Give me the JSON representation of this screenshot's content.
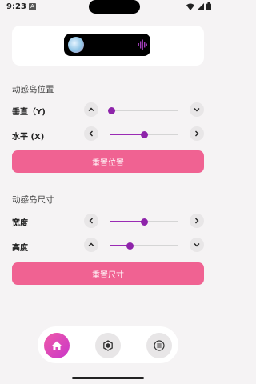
{
  "status_bar": {
    "time": "9:23",
    "notification_letter": "A"
  },
  "island_preview": {
    "icons": [
      "album-art-icon",
      "audio-waveform-icon"
    ]
  },
  "position_section": {
    "title": "动感岛位置",
    "vertical": {
      "label": "垂直（Y)",
      "value_fraction": 0.03
    },
    "horizontal": {
      "label": "水平 (X)",
      "value_fraction": 0.51
    },
    "reset_label": "重置位置"
  },
  "size_section": {
    "title": "动感岛尺寸",
    "width": {
      "label": "宽度",
      "value_fraction": 0.51
    },
    "height": {
      "label": "高度",
      "value_fraction": 0.3
    },
    "reset_label": "重置尺寸"
  },
  "nav": {
    "items": [
      "home-icon",
      "hexagon-box-icon",
      "list-circle-icon"
    ],
    "active": "home-icon"
  },
  "colors": {
    "accent_pink": "#f06292",
    "slider_purple": "#8e24aa",
    "nav_active": "#e040a0"
  }
}
